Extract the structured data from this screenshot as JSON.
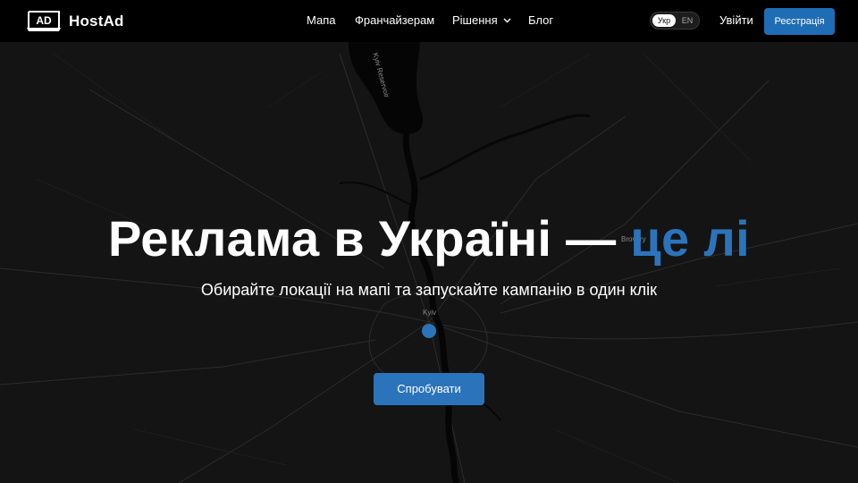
{
  "brand": {
    "name": "HostAd",
    "logo_text": "AD"
  },
  "nav": {
    "items": [
      {
        "label": "Мапа"
      },
      {
        "label": "Франчайзерам"
      },
      {
        "label": "Рішення"
      },
      {
        "label": "Блог"
      }
    ]
  },
  "lang": {
    "active": "Укр",
    "other": "EN"
  },
  "auth": {
    "login": "Увійти",
    "register": "Реєстрація"
  },
  "hero": {
    "title_main": "Реклама в Україні — ",
    "title_accent": "це лі",
    "subtitle": "Обирайте локації на мапі та запускайте кампанію в один клік",
    "cta": "Спробувати"
  },
  "map_labels": {
    "city": "Kyiv",
    "suburb": "Brovary",
    "reservoir": "Kyiv Reservoir"
  },
  "colors": {
    "accent": "#2b74bb",
    "register_bg": "#1f6db5",
    "navbar_bg": "#000000",
    "map_bg": "#141414"
  }
}
